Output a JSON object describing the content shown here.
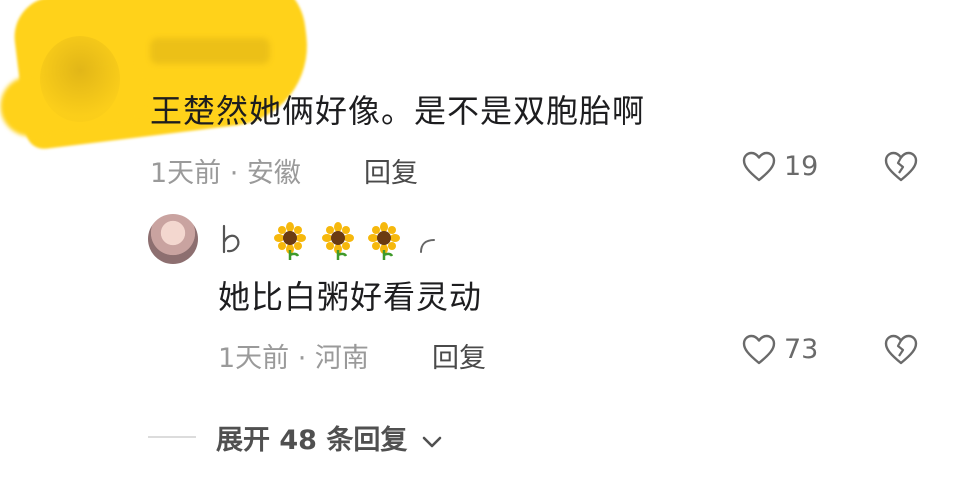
{
  "comment": {
    "text": "王楚然她俩好像。是不是双胞胎啊",
    "meta": "1天前 · 安徽",
    "reply_label": "回复",
    "like_count": "19"
  },
  "reply": {
    "name_emojis": "🌻 🌻 🌻",
    "text": "她比白粥好看灵动",
    "meta": "1天前 · 河南",
    "reply_label": "回复",
    "like_count": "73"
  },
  "expand_label": "展开 48 条回复",
  "colors": {
    "highlight": "#ffd21a",
    "text": "#1d1d1f",
    "meta": "#9a9a9a"
  },
  "icons": [
    "heart-icon",
    "dislike-broken-heart-icon",
    "chevron-down-icon",
    "sunflower-emoji"
  ]
}
